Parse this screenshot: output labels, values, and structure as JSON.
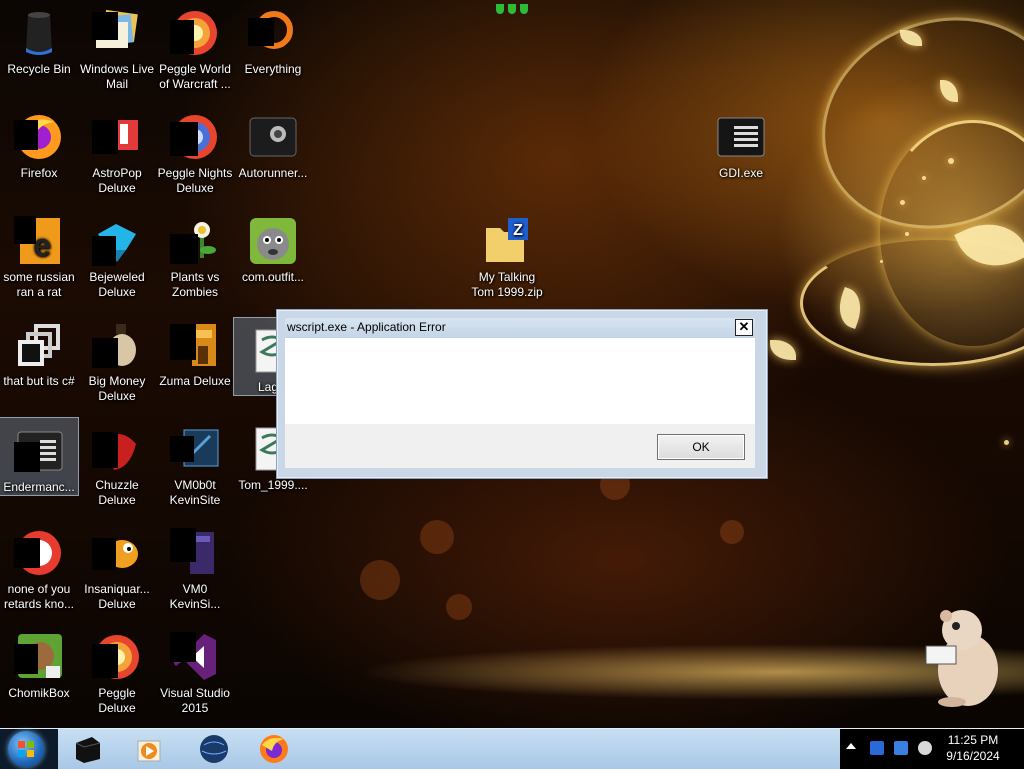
{
  "desktop": {
    "icons": [
      {
        "label": "Recycle Bin",
        "icon": "recycle-bin-icon"
      },
      {
        "label": "Windows Live Mail",
        "icon": "mail-icon"
      },
      {
        "label": "Peggle World of Warcraft ...",
        "icon": "peggle-icon"
      },
      {
        "label": "Everything",
        "icon": "search-icon"
      },
      {
        "label": "Firefox",
        "icon": "firefox-icon"
      },
      {
        "label": "AstroPop Deluxe",
        "icon": "game-icon"
      },
      {
        "label": "Peggle Nights Deluxe",
        "icon": "peggle-icon"
      },
      {
        "label": "Autorunner...",
        "icon": "app-icon"
      },
      {
        "label": "some russian ran a rat",
        "icon": "document-icon"
      },
      {
        "label": "Bejeweled Deluxe",
        "icon": "gem-icon"
      },
      {
        "label": "Plants vs Zombies",
        "icon": "plant-icon"
      },
      {
        "label": "com.outfit...",
        "icon": "talking-tom-icon"
      },
      {
        "label": "that but its c#",
        "icon": "window-icon"
      },
      {
        "label": "Big Money Deluxe",
        "icon": "game-icon"
      },
      {
        "label": "Zuma Deluxe",
        "icon": "game-icon"
      },
      {
        "label": "Lag...",
        "icon": "script-icon"
      },
      {
        "label": "Endermanc...",
        "icon": "console-icon"
      },
      {
        "label": "Chuzzle Deluxe",
        "icon": "game-icon"
      },
      {
        "label": "VM0b0t KevinSite",
        "icon": "shortcut-icon"
      },
      {
        "label": "Tom_1999....",
        "icon": "script-icon"
      },
      {
        "label": "none of you retards kno...",
        "icon": "app-icon"
      },
      {
        "label": "Insaniquar... Deluxe",
        "icon": "fish-icon"
      },
      {
        "label": "VM0 KevinSi...",
        "icon": "shortcut-icon"
      },
      {
        "label": "ChomikBox",
        "icon": "hamster-icon"
      },
      {
        "label": "Peggle Deluxe",
        "icon": "peggle-icon"
      },
      {
        "label": "Visual Studio 2015",
        "icon": "visual-studio-icon"
      },
      {
        "label": "My Talking Tom 1999.zip",
        "icon": "zip-folder-icon"
      },
      {
        "label": "GDI.exe",
        "icon": "console-icon"
      }
    ]
  },
  "dialog": {
    "title": "wscript.exe - Application Error",
    "close_label": "✕",
    "message": "",
    "ok_label": "OK"
  },
  "taskbar": {
    "start": "start-orb-icon",
    "pinned": [
      "cmd-icon",
      "media-player-icon",
      "globe-icon",
      "firefox-icon"
    ],
    "clock": {
      "time": "11:25 PM",
      "date": "9/16/2024"
    }
  },
  "colors": {
    "taskbar": "#b5d1ec",
    "dialog_frame": "#c9d7e6",
    "accent_gold": "#f5c04a"
  }
}
